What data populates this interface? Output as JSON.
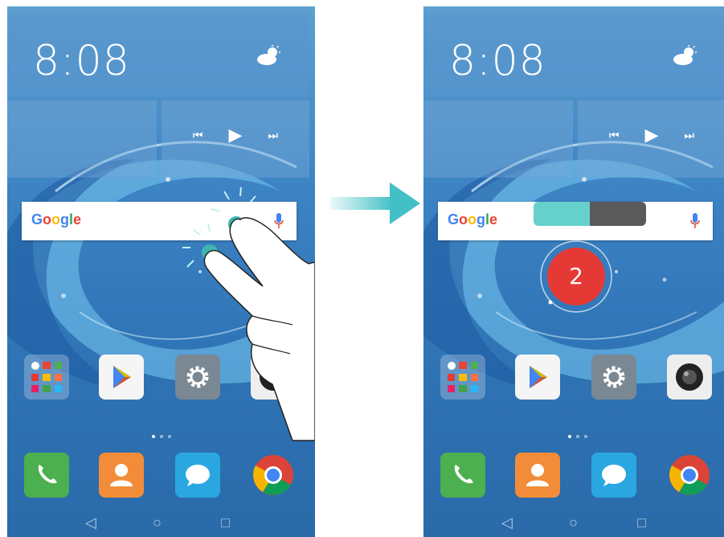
{
  "screen_before": {
    "clock": "8:08",
    "clock_info": [
      "",
      "",
      ""
    ],
    "weather": "partly-cloudy-icon",
    "widget_left_label": "",
    "widget_right_label": "",
    "search": {
      "logo": "Google"
    },
    "apps": [
      {
        "label": "",
        "icon": "folder-icon"
      },
      {
        "label": "",
        "icon": "play-store-icon"
      },
      {
        "label": "",
        "icon": "settings-gear-icon"
      },
      {
        "label": "",
        "icon": "camera-icon"
      }
    ],
    "dock": [
      "phone-icon",
      "contacts-icon",
      "messages-icon",
      "chrome-icon"
    ],
    "nav": {
      "back": "◁",
      "home": "○",
      "recents": "□"
    }
  },
  "screen_after": {
    "clock": "8:08",
    "search": {
      "logo": "Google"
    },
    "quick_tabs": [
      "",
      ""
    ],
    "counter": "2",
    "apps": [
      {
        "label": "",
        "icon": "folder-icon"
      },
      {
        "label": "",
        "icon": "play-store-icon"
      },
      {
        "label": "",
        "icon": "settings-gear-icon"
      },
      {
        "label": "",
        "icon": "camera-icon"
      }
    ],
    "dock": [
      "phone-icon",
      "contacts-icon",
      "messages-icon",
      "chrome-icon"
    ],
    "nav": {
      "back": "◁",
      "home": "○",
      "recents": "□"
    }
  },
  "colors": {
    "accent": "#43c0c5",
    "counter_red": "#e53935",
    "tab_teal": "#66d0cd"
  }
}
